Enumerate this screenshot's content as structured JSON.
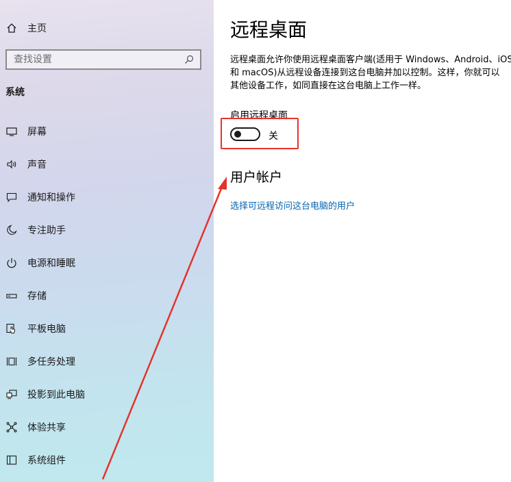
{
  "sidebar": {
    "home_label": "主页",
    "search_placeholder": "查找设置",
    "section_title": "系统",
    "items": [
      {
        "label": "屏幕",
        "icon": "display-icon"
      },
      {
        "label": "声音",
        "icon": "speaker-icon"
      },
      {
        "label": "通知和操作",
        "icon": "notification-icon"
      },
      {
        "label": "专注助手",
        "icon": "moon-icon"
      },
      {
        "label": "电源和睡眠",
        "icon": "power-icon"
      },
      {
        "label": "存储",
        "icon": "storage-icon"
      },
      {
        "label": "平板电脑",
        "icon": "tablet-icon"
      },
      {
        "label": "多任务处理",
        "icon": "multitask-icon"
      },
      {
        "label": "投影到此电脑",
        "icon": "project-icon"
      },
      {
        "label": "体验共享",
        "icon": "share-icon"
      },
      {
        "label": "系统组件",
        "icon": "components-icon"
      }
    ]
  },
  "main": {
    "title": "远程桌面",
    "description": "远程桌面允许你使用远程桌面客户端(适用于 Windows、Android、iOS\n和 macOS)从远程设备连接到这台电脑并加以控制。这样，你就可以\n其他设备工作，如同直接在这台电脑上工作一样。",
    "toggle_label": "启用远程桌面",
    "toggle_state": "关",
    "toggle_on": false,
    "accounts_heading": "用户帐户",
    "accounts_link": "选择可远程访问这台电脑的用户"
  },
  "annotation": {
    "highlight_color": "#e5322b",
    "arrow_color": "#e5322b"
  },
  "colors": {
    "accent_link": "#0063b1"
  }
}
